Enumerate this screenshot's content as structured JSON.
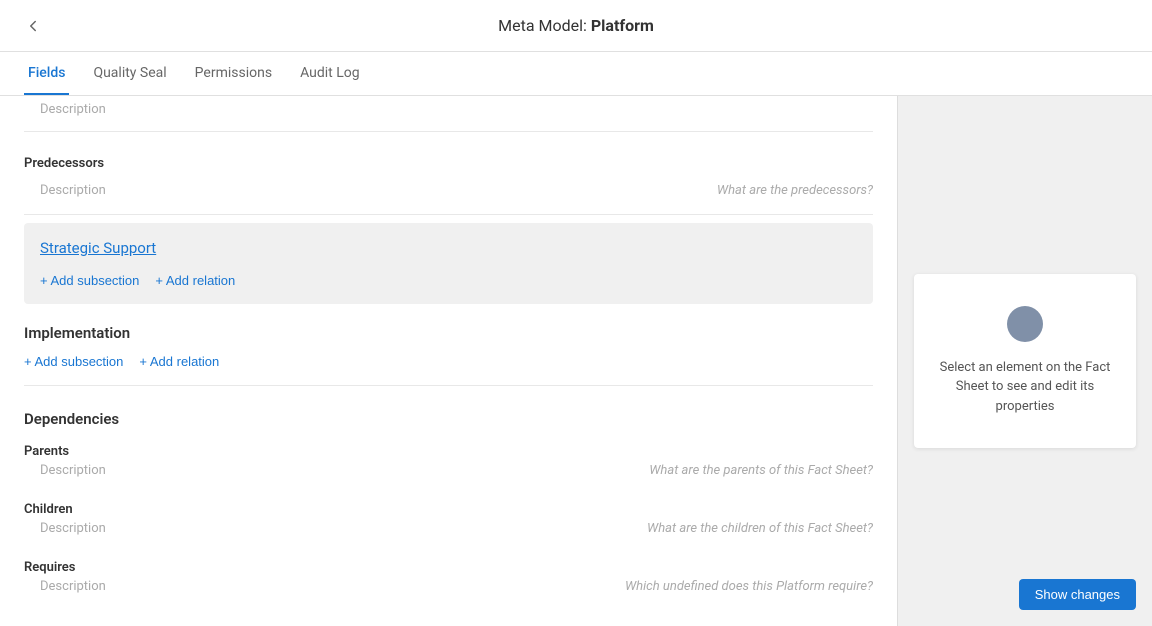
{
  "header": {
    "title": "Meta Model: ",
    "title_bold": "Platform",
    "back_icon": "←"
  },
  "tabs": [
    {
      "label": "Fields",
      "active": true
    },
    {
      "label": "Quality Seal",
      "active": false
    },
    {
      "label": "Permissions",
      "active": false
    },
    {
      "label": "Audit Log",
      "active": false
    }
  ],
  "sections": {
    "description_label": "Description",
    "predecessors": {
      "label": "Predecessors",
      "placeholder": "What are the predecessors?",
      "description": "Description"
    },
    "strategic_support": {
      "title": "Strategic Support",
      "add_subsection": "+ Add subsection",
      "add_relation": "+ Add relation"
    },
    "implementation": {
      "title": "Implementation",
      "add_subsection": "+ Add subsection",
      "add_relation": "+ Add relation"
    },
    "dependencies": {
      "title": "Dependencies",
      "parents": {
        "label": "Parents",
        "placeholder": "What are the parents of this Fact Sheet?",
        "description": "Description"
      },
      "children": {
        "label": "Children",
        "placeholder": "What are the children of this Fact Sheet?",
        "description": "Description"
      },
      "requires": {
        "label": "Requires",
        "placeholder": "Which undefined does this Platform require?",
        "description": "Description"
      }
    }
  },
  "right_panel": {
    "prompt_text": "Select an element on the Fact Sheet to see and edit its properties"
  },
  "footer": {
    "show_changes": "Show changes"
  }
}
